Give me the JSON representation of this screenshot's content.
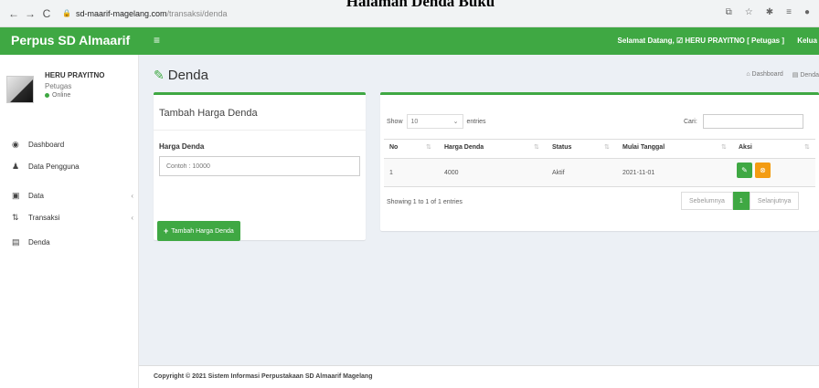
{
  "caption": "Halaman Denda Buku",
  "browser": {
    "url_host": "sd-maarif-magelang.com",
    "url_path": "/transaksi/denda"
  },
  "topbar": {
    "brand": "Perpus SD Almaarif",
    "welcome": "Selamat Datang, ☑ HERU PRAYITNO [ Petugas ]",
    "logout": "Kelua"
  },
  "user": {
    "name": "HERU PRAYITNO",
    "role": "Petugas",
    "status": "Online"
  },
  "sidebar": {
    "items": [
      {
        "label": "Dashboard",
        "icon": "dashboard-icon"
      },
      {
        "label": "Data Pengguna",
        "icon": "user-icon"
      },
      {
        "label": "Data",
        "icon": "folder-icon"
      },
      {
        "label": "Transaksi",
        "icon": "transaction-icon"
      },
      {
        "label": "Denda",
        "icon": "money-icon"
      }
    ]
  },
  "page": {
    "title": "Denda",
    "breadcrumb_home": "Dashboard",
    "breadcrumb_current": "Denda"
  },
  "form": {
    "title": "Tambah Harga Denda",
    "field_label": "Harga Denda",
    "placeholder": "Contoh : 10000",
    "button": "Tambah Harga Denda"
  },
  "table": {
    "show_label": "Show",
    "show_value": "10",
    "entries_label": "entries",
    "search_label": "Cari:",
    "columns": [
      "No",
      "Harga Denda",
      "Status",
      "Mulai Tanggal",
      "Aksi"
    ],
    "rows": [
      {
        "no": "1",
        "harga": "4000",
        "status": "Aktif",
        "tanggal": "2021-11-01"
      }
    ],
    "info": "Showing 1 to 1 of 1 entries",
    "pager": {
      "prev": "Sebelumnya",
      "current": "1",
      "next": "Selanjutnya"
    }
  },
  "footer": {
    "text": "Copyright © 2021 Sistem Informasi Perpustakaan SD Almaarif Magelang"
  },
  "colors": {
    "accent": "#3fa843",
    "warning": "#f39c12"
  }
}
